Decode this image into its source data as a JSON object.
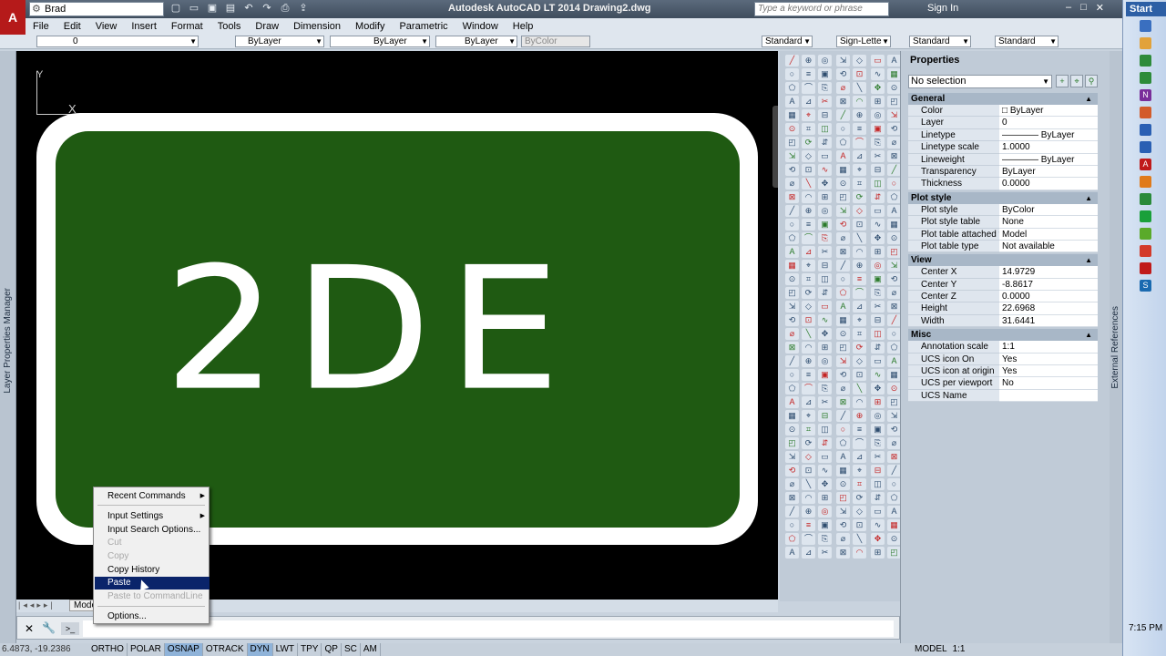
{
  "window": {
    "title": "Autodesk AutoCAD LT 2014   Drawing2.dwg",
    "workspace": "Brad",
    "search_placeholder": "Type a keyword or phrase",
    "signin": "Sign In"
  },
  "menu": [
    "File",
    "Edit",
    "View",
    "Insert",
    "Format",
    "Tools",
    "Draw",
    "Dimension",
    "Modify",
    "Parametric",
    "Window",
    "Help"
  ],
  "toolbar": {
    "layer": "0",
    "color": "ByLayer",
    "linetype": "ByLayer",
    "lineweight": "ByLayer",
    "plotstyle": "ByColor",
    "text_style": "Standard",
    "dim_style": "Sign-Lette",
    "table_style": "Standard",
    "mleader_style": "Standard"
  },
  "left_palette_label": "Layer Properties Manager",
  "right_palette_label": "External References",
  "drawing": {
    "ucs_y": "Y",
    "ucs_x": "X",
    "sign_text": "2DE",
    "sign_bg": "#1f5a12"
  },
  "model_tab": "Model",
  "properties": {
    "title": "Properties",
    "selection": "No selection",
    "sections": [
      {
        "name": "General",
        "rows": [
          [
            "Color",
            "□ ByLayer"
          ],
          [
            "Layer",
            "0"
          ],
          [
            "Linetype",
            "———— ByLayer"
          ],
          [
            "Linetype scale",
            "1.0000"
          ],
          [
            "Lineweight",
            "———— ByLayer"
          ],
          [
            "Transparency",
            "ByLayer"
          ],
          [
            "Thickness",
            "0.0000"
          ]
        ]
      },
      {
        "name": "Plot style",
        "rows": [
          [
            "Plot style",
            "ByColor"
          ],
          [
            "Plot style table",
            "None"
          ],
          [
            "Plot table attached to",
            "Model"
          ],
          [
            "Plot table type",
            "Not available"
          ]
        ]
      },
      {
        "name": "View",
        "rows": [
          [
            "Center X",
            "14.9729"
          ],
          [
            "Center Y",
            "-8.8617"
          ],
          [
            "Center Z",
            "0.0000"
          ],
          [
            "Height",
            "22.6968"
          ],
          [
            "Width",
            "31.6441"
          ]
        ]
      },
      {
        "name": "Misc",
        "rows": [
          [
            "Annotation scale",
            "1:1"
          ],
          [
            "UCS icon On",
            "Yes"
          ],
          [
            "UCS icon at origin",
            "Yes"
          ],
          [
            "UCS per viewport",
            "No"
          ],
          [
            "UCS Name",
            ""
          ]
        ]
      }
    ]
  },
  "context_menu": [
    {
      "label": "Recent Commands",
      "state": "normal",
      "sub": true
    },
    {
      "label": "Input Settings",
      "state": "normal",
      "sub": true
    },
    {
      "label": "Input Search Options...",
      "state": "normal",
      "sub": false
    },
    {
      "label": "Cut",
      "state": "disabled",
      "sub": false
    },
    {
      "label": "Copy",
      "state": "disabled",
      "sub": false
    },
    {
      "label": "Copy History",
      "state": "normal",
      "sub": false
    },
    {
      "label": "Paste",
      "state": "selected",
      "sub": false
    },
    {
      "label": "Paste to CommandLine",
      "state": "disabled",
      "sub": false
    },
    {
      "label": "Options...",
      "state": "normal",
      "sub": false
    }
  ],
  "status": {
    "coords": "6.4873, -19.2386",
    "toggles": [
      {
        "label": "ORTHO",
        "on": false
      },
      {
        "label": "POLAR",
        "on": false
      },
      {
        "label": "OSNAP",
        "on": true
      },
      {
        "label": "OTRACK",
        "on": false
      },
      {
        "label": "DYN",
        "on": true
      },
      {
        "label": "LWT",
        "on": false
      },
      {
        "label": "TPY",
        "on": false
      },
      {
        "label": "QP",
        "on": false
      },
      {
        "label": "SC",
        "on": false
      },
      {
        "label": "AM",
        "on": false
      }
    ],
    "space": "MODEL",
    "scale": "1:1"
  },
  "taskbar": {
    "start": "Start",
    "clock": "7:15 PM"
  }
}
